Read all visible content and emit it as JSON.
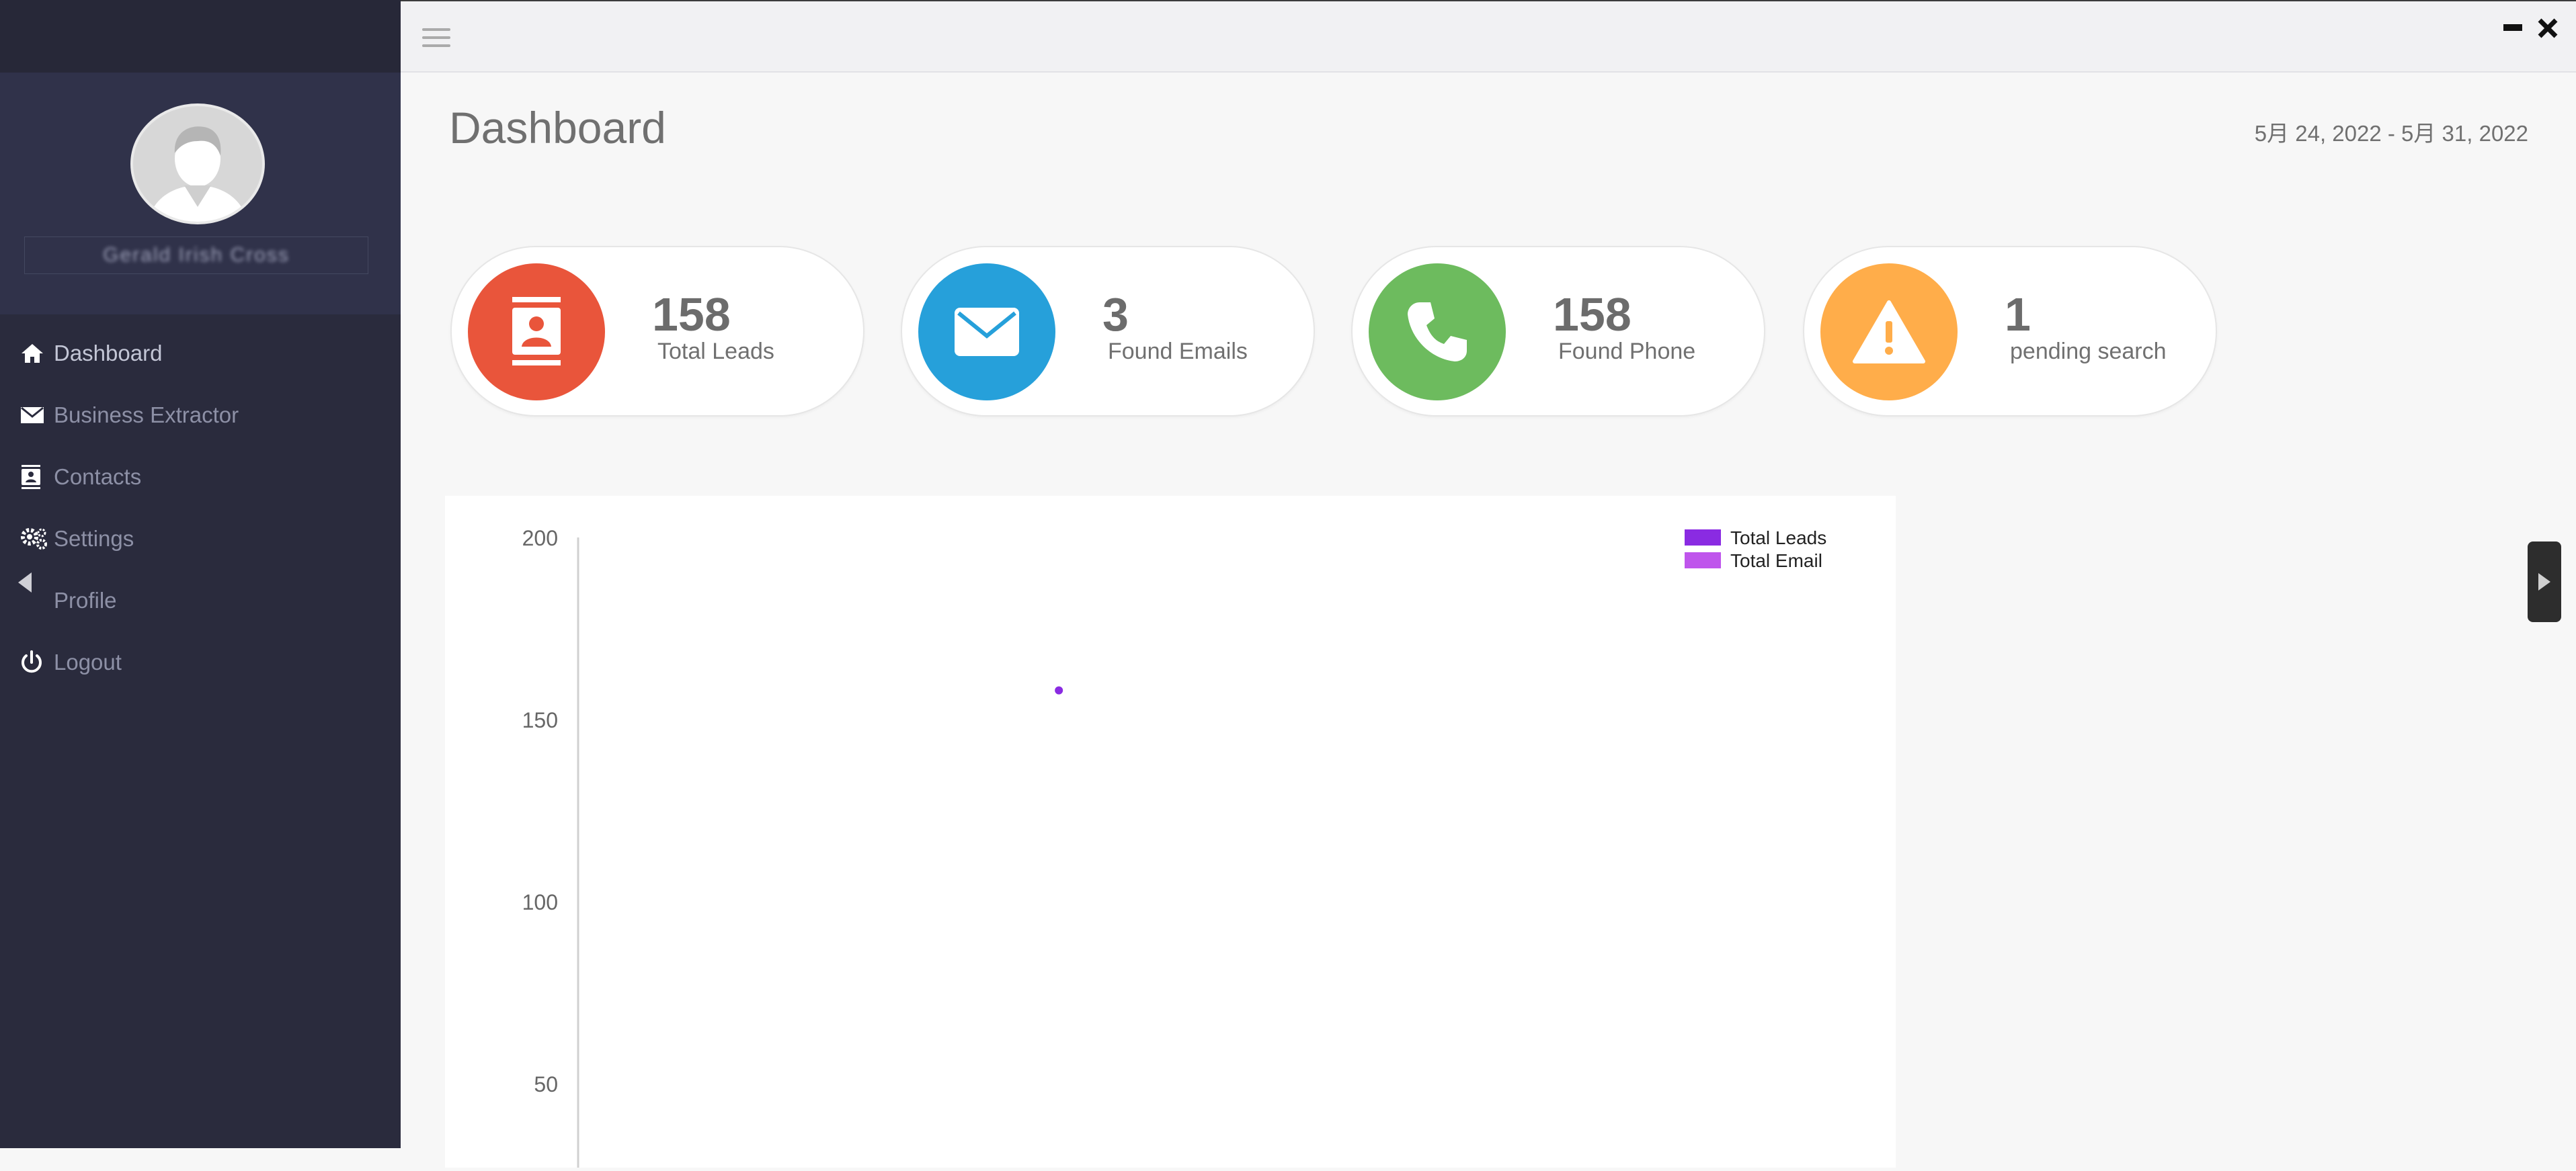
{
  "user": {
    "name": "Gerald Irish Cross"
  },
  "sidebar": {
    "items": [
      {
        "label": "Dashboard",
        "icon": "home-icon"
      },
      {
        "label": "Business Extractor",
        "icon": "envelope-icon"
      },
      {
        "label": "Contacts",
        "icon": "contact-card-icon"
      },
      {
        "label": "Settings",
        "icon": "gears-icon"
      },
      {
        "label": "Profile",
        "icon": "user-icon"
      },
      {
        "label": "Logout",
        "icon": "power-icon"
      }
    ]
  },
  "header": {
    "title": "Dashboard",
    "date_range": "5月 24, 2022 - 5月 31, 2022"
  },
  "stats": [
    {
      "value": "158",
      "label": "Total Leads",
      "color": "#e9553b",
      "icon": "contact-card-icon"
    },
    {
      "value": "3",
      "label": "Found Emails",
      "color": "#26a0da",
      "icon": "envelope-icon"
    },
    {
      "value": "158",
      "label": "Found Phone",
      "color": "#6dbb5e",
      "icon": "phone-icon"
    },
    {
      "value": "1",
      "label": "pending search",
      "color": "#ffad4a",
      "icon": "warning-icon"
    }
  ],
  "chart_data": {
    "type": "line",
    "title": "",
    "xlabel": "",
    "ylabel": "",
    "y_ticks": [
      200,
      150,
      100,
      50
    ],
    "ylim": [
      0,
      200
    ],
    "legend_position": "top-right",
    "series": [
      {
        "name": "Total Leads",
        "color": "#8a2be2",
        "points": [
          {
            "x": 0.5,
            "y": 158
          }
        ]
      },
      {
        "name": "Total Email",
        "color": "#bf55ec",
        "points": []
      }
    ]
  }
}
